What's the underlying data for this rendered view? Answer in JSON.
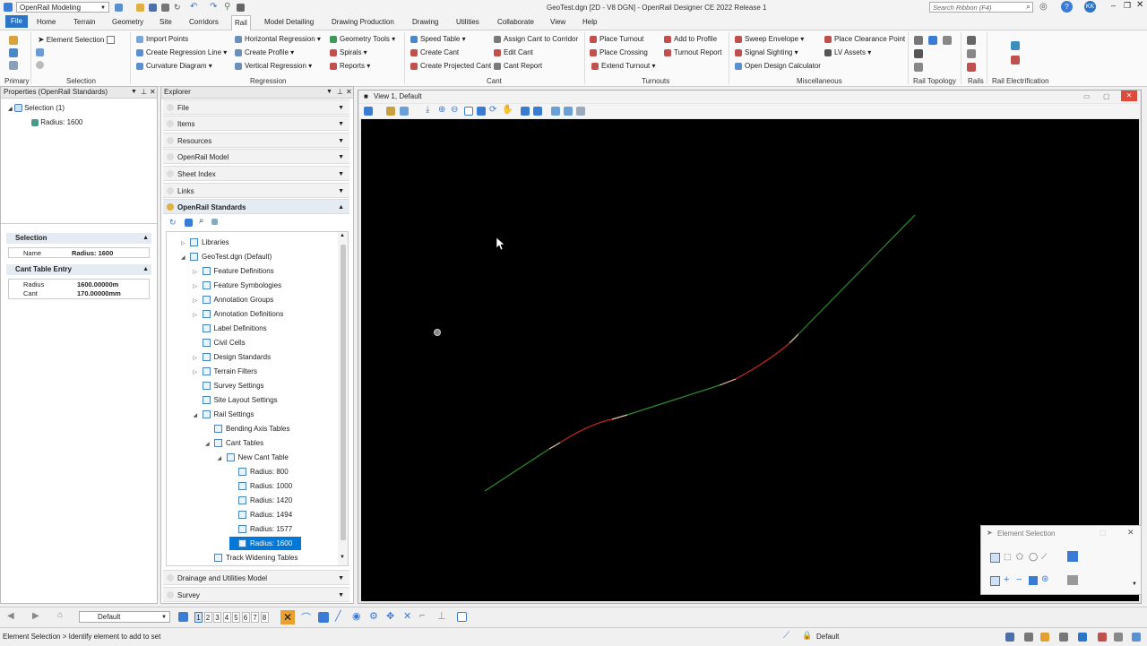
{
  "titlebar": {
    "workspace": "OpenRail Modeling",
    "doc_title": "GeoTest.dgn [2D - V8 DGN] - OpenRail Designer CE 2022 Release 1",
    "search_placeholder": "Search Ribbon (F4)",
    "user_initials": "KK"
  },
  "tabs": [
    "File",
    "Home",
    "Terrain",
    "Geometry",
    "Site",
    "Corridors",
    "Rail",
    "Model Detailing",
    "Drawing Production",
    "Drawing",
    "Utilities",
    "Collaborate",
    "View",
    "Help"
  ],
  "ribbon": {
    "primary_label": "Primary",
    "selection": {
      "label": "Selection",
      "element_selection": "Element Selection"
    },
    "regression": {
      "label": "Regression",
      "import_points": "Import Points",
      "create_regression_line": "Create Regression Line",
      "curvature_diagram": "Curvature Diagram",
      "horizontal_regression": "Horizontal Regression",
      "create_profile": "Create Profile",
      "vertical_regression": "Vertical Regression",
      "geometry_tools": "Geometry Tools",
      "spirals": "Spirals",
      "reports": "Reports"
    },
    "cant": {
      "label": "Cant",
      "speed_table": "Speed Table",
      "create_cant": "Create Cant",
      "create_projected_cant": "Create Projected Cant",
      "assign_cant_to_corridor": "Assign Cant to Corridor",
      "edit_cant": "Edit Cant",
      "cant_report": "Cant Report"
    },
    "turnouts": {
      "label": "Turnouts",
      "place_turnout": "Place Turnout",
      "place_crossing": "Place Crossing",
      "extend_turnout": "Extend Turnout",
      "add_to_profile": "Add to Profile",
      "turnout_report": "Turnout Report"
    },
    "misc": {
      "label": "Miscellaneous",
      "sweep_envelope": "Sweep Envelope",
      "signal_sighting": "Signal Sighting",
      "open_design_calculator": "Open Design Calculator",
      "place_clearance_point": "Place Clearance Point",
      "lv_assets": "LV Assets"
    },
    "rail_topology": "Rail Topology",
    "rails": "Rails",
    "rail_electrification": "Rail Electrification"
  },
  "properties": {
    "title": "Properties (OpenRail Standards)",
    "tree_root": "Selection (1)",
    "tree_child": "Radius: 1600",
    "section_selection": "Selection",
    "name_key": "Name",
    "name_val": "Radius: 1600",
    "section_cant": "Cant Table Entry",
    "radius_key": "Radius",
    "radius_val": "1600.00000m",
    "cant_key": "Cant",
    "cant_val": "170.00000mm"
  },
  "explorer": {
    "title": "Explorer",
    "sections": [
      "File",
      "Items",
      "Resources",
      "OpenRail Model",
      "Sheet Index",
      "Links"
    ],
    "open_section": "OpenRail Standards",
    "tree": [
      {
        "label": "Libraries",
        "level": 1,
        "tw": "▷"
      },
      {
        "label": "GeoTest.dgn (Default)",
        "level": 1,
        "tw": "◢"
      },
      {
        "label": "Feature Definitions",
        "level": 2,
        "tw": "▷"
      },
      {
        "label": "Feature Symbologies",
        "level": 2,
        "tw": "▷"
      },
      {
        "label": "Annotation Groups",
        "level": 2,
        "tw": "▷"
      },
      {
        "label": "Annotation Definitions",
        "level": 2,
        "tw": "▷"
      },
      {
        "label": "Label Definitions",
        "level": 2,
        "tw": ""
      },
      {
        "label": "Civil Cells",
        "level": 2,
        "tw": ""
      },
      {
        "label": "Design Standards",
        "level": 2,
        "tw": "▷"
      },
      {
        "label": "Terrain Filters",
        "level": 2,
        "tw": "▷"
      },
      {
        "label": "Survey Settings",
        "level": 2,
        "tw": ""
      },
      {
        "label": "Site Layout Settings",
        "level": 2,
        "tw": ""
      },
      {
        "label": "Rail Settings",
        "level": 2,
        "tw": "◢"
      },
      {
        "label": "Bending Axis Tables",
        "level": 3,
        "tw": ""
      },
      {
        "label": "Cant Tables",
        "level": 3,
        "tw": "◢"
      },
      {
        "label": "New Cant Table",
        "level": 4,
        "tw": "◢"
      },
      {
        "label": "Radius: 800",
        "level": 5,
        "tw": ""
      },
      {
        "label": "Radius: 1000",
        "level": 5,
        "tw": ""
      },
      {
        "label": "Radius: 1420",
        "level": 5,
        "tw": ""
      },
      {
        "label": "Radius: 1494",
        "level": 5,
        "tw": ""
      },
      {
        "label": "Radius: 1577",
        "level": 5,
        "tw": ""
      },
      {
        "label": "Radius: 1600",
        "level": 5,
        "tw": "",
        "selected": true
      },
      {
        "label": "Track Widening Tables",
        "level": 3,
        "tw": ""
      }
    ],
    "bottom_sections": [
      "Drainage and Utilities Model",
      "Survey"
    ]
  },
  "view": {
    "title": "View 1, Default"
  },
  "element_selection_dialog": {
    "title": "Element Selection"
  },
  "bottom_toolbar": {
    "level": "Default",
    "view_numbers": [
      "1",
      "2",
      "3",
      "4",
      "5",
      "6",
      "7",
      "8"
    ]
  },
  "status": {
    "prompt": "Element Selection > Identify element to add to set",
    "level": "Default"
  },
  "colors": {
    "accent": "#0078d7",
    "canvas": "#000000",
    "tangent": "#2e8b2e",
    "curve": "#c0281e",
    "spiral": "#e8c8a0"
  }
}
